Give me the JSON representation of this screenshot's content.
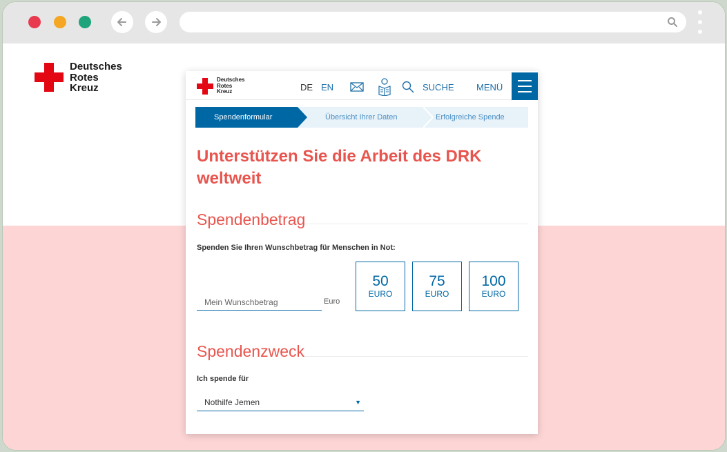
{
  "browser": {
    "url": ""
  },
  "brand": {
    "line1": "Deutsches",
    "line2": "Rotes",
    "line3": "Kreuz",
    "red": "#e30613"
  },
  "header": {
    "lang_de": "DE",
    "lang_en": "EN",
    "search_label": "SUCHE",
    "menu_label": "MENÜ"
  },
  "steps": [
    {
      "label": "Spendenformular",
      "active": true
    },
    {
      "label": "Übersicht Ihrer Daten",
      "active": false
    },
    {
      "label": "Erfolgreiche Spende",
      "active": false
    }
  ],
  "main": {
    "headline": "Unterstützen Sie die Arbeit des DRK weltweit",
    "amount_section": {
      "title": "Spendenbetrag",
      "label": "Spenden Sie Ihren Wunschbetrag für Menschen in Not:",
      "input_placeholder": "Mein Wunschbetrag",
      "input_suffix": "Euro",
      "options": [
        {
          "amount": "50",
          "currency": "EURO"
        },
        {
          "amount": "75",
          "currency": "EURO"
        },
        {
          "amount": "100",
          "currency": "EURO"
        }
      ]
    },
    "purpose_section": {
      "title": "Spendenzweck",
      "label": "Ich spende für",
      "selected": "Nothilfe Jemen"
    }
  },
  "colors": {
    "accent_blue": "#0067a5",
    "headline_red": "#e8554e",
    "backdrop_pink": "#fdd5d5"
  }
}
